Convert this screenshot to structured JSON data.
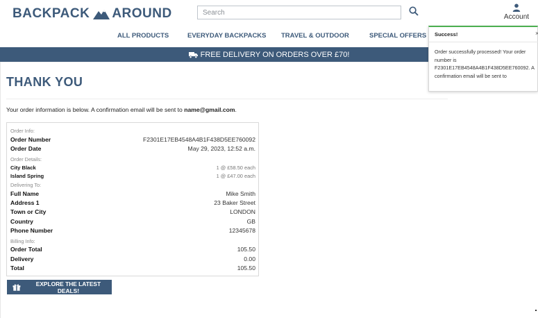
{
  "brand": {
    "name_left": "BACKPACK",
    "name_right": "AROUND",
    "logo_icon": "mountain-icon"
  },
  "search": {
    "placeholder": "Search",
    "button_icon": "search-icon"
  },
  "account": {
    "label": "Account",
    "icon": "user-icon"
  },
  "nav": {
    "items": [
      {
        "label": "ALL PRODUCTS"
      },
      {
        "label": "EVERYDAY BACKPACKS"
      },
      {
        "label": "TRAVEL & OUTDOOR"
      },
      {
        "label": "SPECIAL OFFERS"
      }
    ]
  },
  "banner": {
    "text": "FREE DELIVERY ON ORDERS OVER £70!",
    "icon": "truck-icon"
  },
  "page": {
    "title": "THANK YOU",
    "intro_prefix": "Your order information is below. A confirmation email will be sent to",
    "email": "name@gmail.com",
    "intro_suffix": "."
  },
  "order": {
    "order_info_heading": "Order Info:",
    "order_number_label": "Order Number",
    "order_number": "F2301E17EB4548A4B1F438D5EE760092",
    "order_date_label": "Order Date",
    "order_date": "May 29, 2023, 12:52 a.m.",
    "details_heading": "Order Details:",
    "items": [
      {
        "name": "City Black",
        "qty_price": "1 @ £58.50 each"
      },
      {
        "name": "Island Spring",
        "qty_price": "1 @ £47.00 each"
      }
    ],
    "delivering_heading": "Delivering To:",
    "full_name_label": "Full Name",
    "full_name": "Mike Smith",
    "address1_label": "Address 1",
    "address1": "23 Baker Street",
    "town_label": "Town or City",
    "town": "LONDON",
    "country_label": "Country",
    "country": "GB",
    "phone_label": "Phone Number",
    "phone": "12345678",
    "billing_heading": "Billing Info:",
    "order_total_label": "Order Total",
    "order_total": "105.50",
    "delivery_label": "Delivery",
    "delivery": "0.00",
    "total_label": "Total",
    "total": "105.50"
  },
  "cta": {
    "label": "EXPLORE THE LATEST DEALS!",
    "icon": "gift-icon"
  },
  "toast": {
    "title": "Success!",
    "message": "Order successfully processed! Your order number is F2301E17EB4548A4B1F438D5EE760092. A confirmation email will be sent to name@gmail.com.",
    "close_icon": "close-icon"
  },
  "colors": {
    "primary": "#3d5a7a",
    "success": "#4caf50"
  }
}
